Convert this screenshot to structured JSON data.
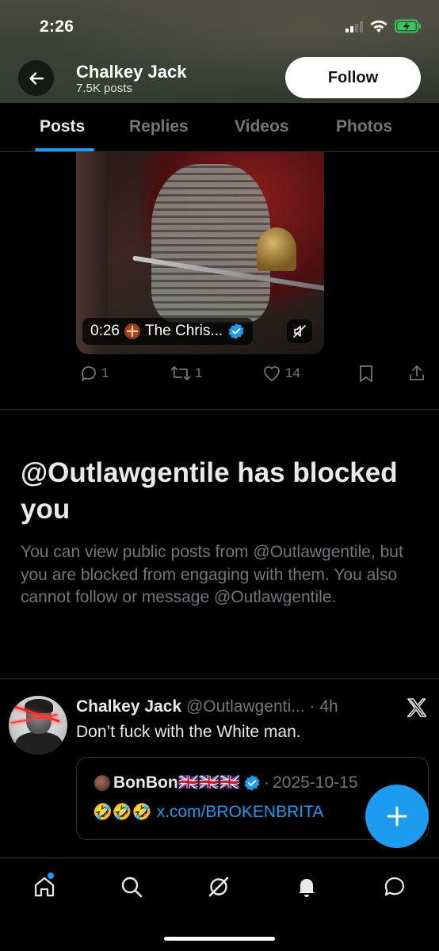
{
  "status_bar": {
    "time": "2:26"
  },
  "header": {
    "profile_name": "Chalkey Jack",
    "post_count": "7.5K posts",
    "follow_label": "Follow"
  },
  "tabs": [
    {
      "label": "Posts",
      "active": true
    },
    {
      "label": "Replies",
      "active": false
    },
    {
      "label": "Videos",
      "active": false
    },
    {
      "label": "Photos",
      "active": false
    }
  ],
  "media_post": {
    "video_time": "0:26",
    "video_title": "The Chris...",
    "actions": {
      "replies": "1",
      "reposts": "1",
      "likes": "14"
    }
  },
  "blocked_notice": {
    "title": "@Outlawgentile has blocked you",
    "body": "You can view public posts from @Outlawgentile, but you are blocked from engaging with them. You also cannot follow or message @Outlawgentile."
  },
  "post": {
    "author": "Chalkey Jack",
    "handle": "@Outlawgenti...",
    "separator": "·",
    "time": "4h",
    "text": "Don’t fuck with the White man.",
    "quote": {
      "author": "BonBon🇬🇧🇬🇧🇬🇧",
      "separator": "·",
      "date": "2025-10-15",
      "emojis": "🤣🤣🤣",
      "link": "x.com/BROKENBRITA"
    }
  },
  "colors": {
    "accent": "#1d9bf0",
    "background": "#000000",
    "text_primary": "#e7e9ea",
    "text_secondary": "#71767b",
    "divider": "#2f3336"
  },
  "icons": {
    "back": "arrow-left-icon",
    "verified": "verified-badge-icon",
    "mute": "speaker-muted-icon",
    "nav": [
      "home-icon",
      "search-icon",
      "grok-icon",
      "notifications-icon",
      "messages-icon"
    ],
    "fab": "plus-icon",
    "brand": "x-logo-icon"
  }
}
